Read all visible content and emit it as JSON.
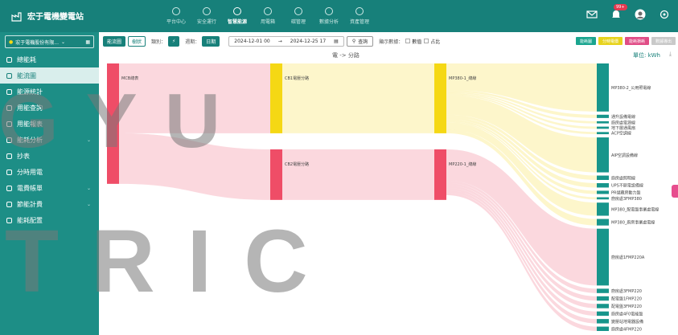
{
  "app": {
    "title": "宏于電機變電站"
  },
  "topnav": [
    {
      "label": "平台中心"
    },
    {
      "label": "安全運行"
    },
    {
      "label": "智慧能源",
      "active": true
    },
    {
      "label": "用電箱"
    },
    {
      "label": "碳管理"
    },
    {
      "label": "數據分析"
    },
    {
      "label": "資產管理"
    }
  ],
  "topright": {
    "badge": "99+"
  },
  "sidebar": {
    "site": "宏于電機股份有限...",
    "items": [
      {
        "label": "總能耗",
        "icon": "leaf-icon"
      },
      {
        "label": "能流圖",
        "icon": "flow-icon",
        "active": true
      },
      {
        "label": "能源統計",
        "icon": "stats-icon"
      },
      {
        "label": "用能查詢",
        "icon": "table-icon"
      },
      {
        "label": "用能報表",
        "icon": "report-icon"
      },
      {
        "label": "能耗分析",
        "icon": "chart-icon",
        "chev": "⌄"
      },
      {
        "label": "抄表",
        "icon": "clock-icon"
      },
      {
        "label": "分時用電",
        "icon": "dot-icon"
      },
      {
        "label": "電費帳單",
        "icon": "bill-icon",
        "chev": "⌄"
      },
      {
        "label": "節能計費",
        "icon": "save-icon",
        "chev": "⌄"
      },
      {
        "label": "能耗配置",
        "icon": "config-icon"
      }
    ]
  },
  "toolbar": {
    "b1": "能流圖",
    "b2": "樹狀",
    "type_label": "類別：",
    "period_label": "週期：",
    "period_value": "日期",
    "date_start": "2024-12-01 00",
    "date_sep": "→",
    "date_end": "2024-12-25 17",
    "query": "查詢",
    "show_label": "顯示數據：",
    "chk1": "數值",
    "chk2": "占比",
    "right_buttons": [
      {
        "label": "能耗圖",
        "color": "#1aa58f"
      },
      {
        "label": "分時電價",
        "color": "#e7d31d"
      },
      {
        "label": "能耗損耗",
        "color": "#e04d86"
      },
      {
        "label": "數據導出",
        "color": "#c9c9c9"
      }
    ]
  },
  "chart": {
    "title": "電 -> 分路",
    "unit": "單位: kWh",
    "download": "⤓"
  },
  "chart_data": {
    "type": "sankey",
    "nodes": [
      {
        "name": "MCB總表",
        "layer": 0,
        "value": 100,
        "color": "#ef4d67"
      },
      {
        "name": "CB1電壓分路",
        "layer": 1,
        "value": 58,
        "color": "#f5d814"
      },
      {
        "name": "CB2電壓分路",
        "layer": 1,
        "value": 42,
        "color": "#ef4d67"
      },
      {
        "name": "MP380-1_總線",
        "layer": 2,
        "value": 58,
        "color": "#f5d814"
      },
      {
        "name": "MP220-1_總線",
        "layer": 2,
        "value": 42,
        "color": "#ef4d67"
      },
      {
        "name": "MP380-2_公用照電線",
        "layer": 3,
        "value": 22,
        "color": "#17958b"
      },
      {
        "name": "通升設備電線",
        "layer": 3,
        "value": 1.5,
        "color": "#17958b"
      },
      {
        "name": "廚房處電源線",
        "layer": 3,
        "value": 1,
        "color": "#17958b"
      },
      {
        "name": "地下層通風扇",
        "layer": 3,
        "value": 1,
        "color": "#17958b"
      },
      {
        "name": "ACP空調線",
        "layer": 3,
        "value": 1,
        "color": "#17958b"
      },
      {
        "name": "AIP空調設備線",
        "layer": 3,
        "value": 16,
        "color": "#17958b"
      },
      {
        "name": "廚房處照明線",
        "layer": 3,
        "value": 2,
        "color": "#17958b"
      },
      {
        "name": "UPS不斷電設備線",
        "layer": 3,
        "value": 2,
        "color": "#17958b"
      },
      {
        "name": "PR儲藏房動力盤",
        "layer": 3,
        "value": 1.5,
        "color": "#17958b"
      },
      {
        "name": "廚房處3FMP380",
        "layer": 3,
        "value": 1,
        "color": "#17958b"
      },
      {
        "name": "MP380_配電盤事業處電線",
        "layer": 3,
        "value": 6,
        "color": "#17958b"
      },
      {
        "name": "MP380_廚房事業處電線",
        "layer": 3,
        "value": 3,
        "color": "#17958b"
      },
      {
        "name": "廚房處1FMP220A",
        "layer": 3,
        "value": 26,
        "color": "#17958b"
      },
      {
        "name": "廚房處3FMP220",
        "layer": 3,
        "value": 2,
        "color": "#17958b"
      },
      {
        "name": "配電盤1FMP220",
        "layer": 3,
        "value": 2,
        "color": "#17958b"
      },
      {
        "name": "配電盤3FMP220",
        "layer": 3,
        "value": 2,
        "color": "#17958b"
      },
      {
        "name": "廚房處4F0電能盤",
        "layer": 3,
        "value": 2,
        "color": "#17958b"
      },
      {
        "name": "變壓站地電器設備",
        "layer": 3,
        "value": 2,
        "color": "#17958b"
      },
      {
        "name": "廚房處4FMP220",
        "layer": 3,
        "value": 2,
        "color": "#17958b"
      }
    ],
    "links": [
      {
        "source": 0,
        "target": 1,
        "value": 58
      },
      {
        "source": 0,
        "target": 2,
        "value": 42
      },
      {
        "source": 1,
        "target": 3,
        "value": 58
      },
      {
        "source": 2,
        "target": 4,
        "value": 42
      },
      {
        "source": 3,
        "target": 5,
        "value": 22
      },
      {
        "source": 3,
        "target": 6,
        "value": 1.5
      },
      {
        "source": 3,
        "target": 7,
        "value": 1
      },
      {
        "source": 3,
        "target": 8,
        "value": 1
      },
      {
        "source": 3,
        "target": 9,
        "value": 1
      },
      {
        "source": 3,
        "target": 10,
        "value": 16
      },
      {
        "source": 3,
        "target": 11,
        "value": 2
      },
      {
        "source": 3,
        "target": 12,
        "value": 2
      },
      {
        "source": 3,
        "target": 13,
        "value": 1.5
      },
      {
        "source": 3,
        "target": 14,
        "value": 1
      },
      {
        "source": 3,
        "target": 15,
        "value": 6
      },
      {
        "source": 3,
        "target": 16,
        "value": 3
      },
      {
        "source": 4,
        "target": 17,
        "value": 26
      },
      {
        "source": 4,
        "target": 18,
        "value": 2
      },
      {
        "source": 4,
        "target": 19,
        "value": 2
      },
      {
        "source": 4,
        "target": 20,
        "value": 2
      },
      {
        "source": 4,
        "target": 21,
        "value": 2
      },
      {
        "source": 4,
        "target": 22,
        "value": 2
      },
      {
        "source": 4,
        "target": 23,
        "value": 2
      }
    ]
  },
  "watermark": {
    "line1": "GYU",
    "line2": "TRIC"
  }
}
